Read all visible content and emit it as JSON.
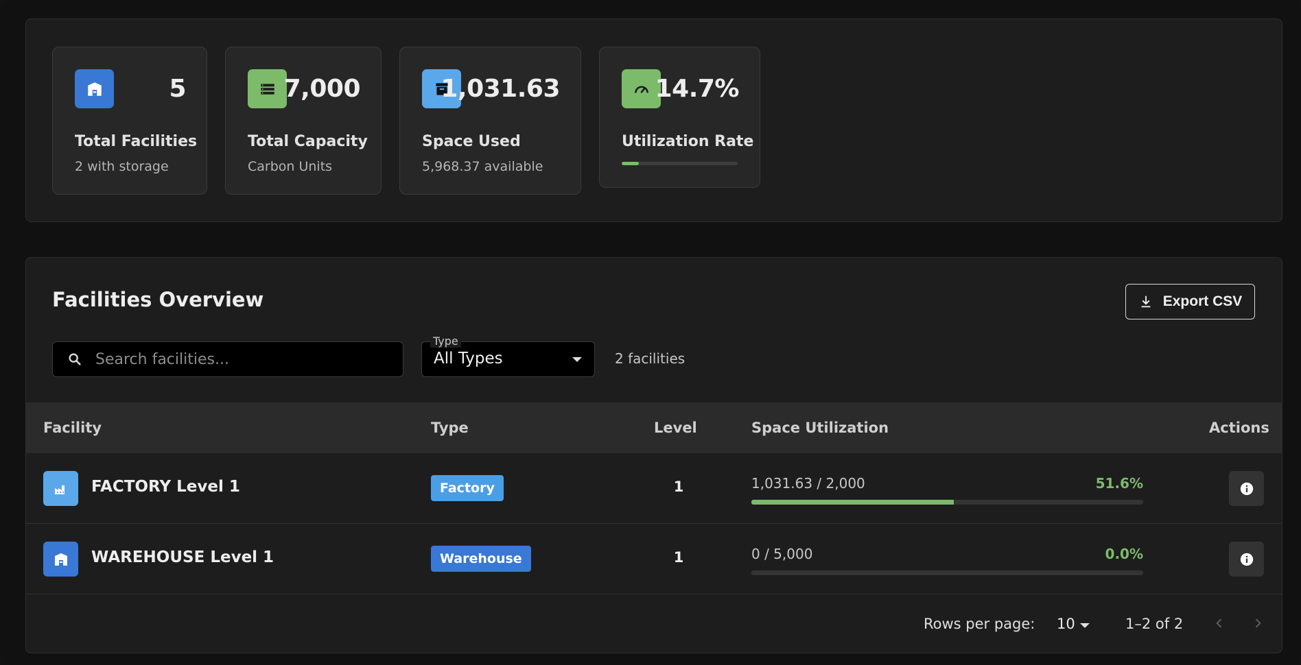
{
  "stats": [
    {
      "value": "5",
      "label": "Total Facilities",
      "sub": "2 with storage",
      "icon": "warehouse-icon",
      "color": "#3a78d6"
    },
    {
      "value": "7,000",
      "label": "Total Capacity",
      "sub": "Carbon Units",
      "icon": "storage-icon",
      "color": "#7cbb6a"
    },
    {
      "value": "1,031.63",
      "label": "Space Used",
      "sub": "5,968.37 available",
      "icon": "archive-icon",
      "color": "#5aa8ea"
    },
    {
      "value": "14.7%",
      "label": "Utilization Rate",
      "icon": "speed-icon",
      "color": "#7cbb6a",
      "progress_percent": 14.7
    }
  ],
  "overview": {
    "title": "Facilities Overview",
    "export_label": "Export CSV",
    "search_placeholder": "Search facilities...",
    "type_filter": {
      "legend": "Type",
      "value": "All Types"
    },
    "count_text": "2 facilities"
  },
  "table": {
    "headers": {
      "facility": "Facility",
      "type": "Type",
      "level": "Level",
      "utilization": "Space Utilization",
      "actions": "Actions"
    },
    "rows": [
      {
        "name": "FACTORY Level 1",
        "type": "Factory",
        "type_color": "#4a9ee6",
        "icon": "factory-icon",
        "icon_color": "#5aa8ea",
        "level": "1",
        "util_text": "1,031.63 / 2,000",
        "util_pct": "51.6%",
        "util_value": 51.6
      },
      {
        "name": "WAREHOUSE Level 1",
        "type": "Warehouse",
        "type_color": "#3a78d6",
        "icon": "warehouse-icon",
        "icon_color": "#3a78d6",
        "level": "1",
        "util_text": "0 / 5,000",
        "util_pct": "0.0%",
        "util_value": 0
      }
    ]
  },
  "pagination": {
    "rows_per_page_label": "Rows per page:",
    "rows_per_page_value": "10",
    "range_text": "1–2 of 2"
  }
}
